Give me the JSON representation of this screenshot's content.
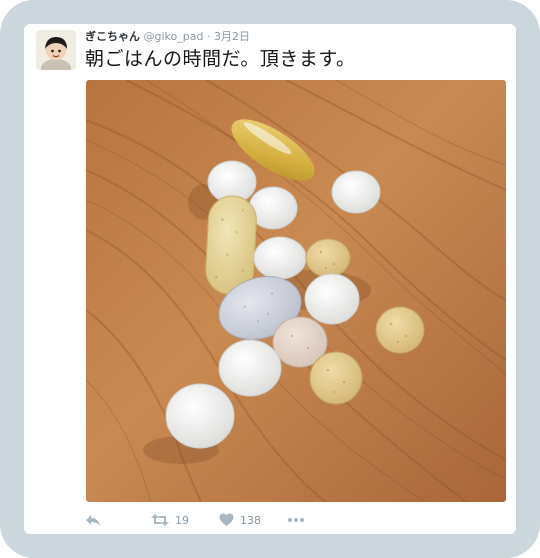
{
  "tweet": {
    "display_name": "ぎこちゃん",
    "handle": "@giko_pad",
    "separator": "·",
    "date": "3月2日",
    "text": "朝ごはんの時間だ。頂きます。"
  },
  "actions": {
    "reply_icon": "reply-icon",
    "retweet_icon": "retweet-icon",
    "retweet_count": "19",
    "like_icon": "heart-icon",
    "like_count": "138",
    "more_icon": "more-icon"
  },
  "colors": {
    "frame": "#ccd6dd",
    "card": "#ffffff",
    "muted": "#8899a6",
    "text": "#14171a"
  }
}
